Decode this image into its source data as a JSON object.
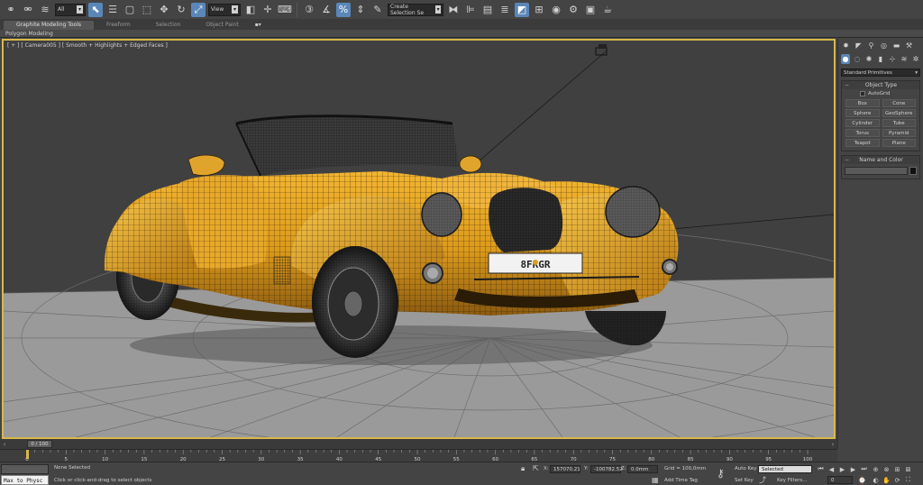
{
  "toolbar": {
    "selection_filter": "All",
    "ref_coord": "View",
    "named_selection": "Create Selection Se"
  },
  "ribbon": {
    "tabs": [
      "Graphite Modeling Tools",
      "Freeform",
      "Selection",
      "Object Paint"
    ],
    "panel_label": "Polygon Modeling"
  },
  "viewport": {
    "label": "[ + ] [ Camera005 ] [ Smooth + Highlights + Edged Faces ]",
    "plate_text": "8FRGR"
  },
  "command_panel": {
    "category": "Standard Primitives",
    "object_type_title": "Object Type",
    "autogrid_label": "AutoGrid",
    "buttons": [
      "Box",
      "Cone",
      "Sphere",
      "GeoSphere",
      "Cylinder",
      "Tube",
      "Torus",
      "Pyramid",
      "Teapot",
      "Plane"
    ],
    "name_color_title": "Name and Color"
  },
  "timeline": {
    "frame_display": "0 / 100",
    "ticks": [
      "0",
      "5",
      "10",
      "15",
      "20",
      "25",
      "30",
      "35",
      "40",
      "45",
      "50",
      "55",
      "60",
      "65",
      "70",
      "75",
      "80",
      "85",
      "90",
      "95",
      "100"
    ]
  },
  "status": {
    "maxscript": "Max to Physc",
    "selected": "None Selected",
    "prompt": "Click or click-and-drag to select objects",
    "x_label": "X:",
    "x_value": "157070.21",
    "y_label": "Y:",
    "y_value": "-100782.52",
    "z_label": "Z:",
    "z_value": "0.0mm",
    "grid": "Grid = 100,0mm",
    "add_time_tag": "Add Time Tag",
    "auto_key": "Auto Key",
    "set_key": "Set Key",
    "selected_dropdown": "Selected",
    "key_filters": "Key Filters...",
    "frame_value": "0"
  }
}
